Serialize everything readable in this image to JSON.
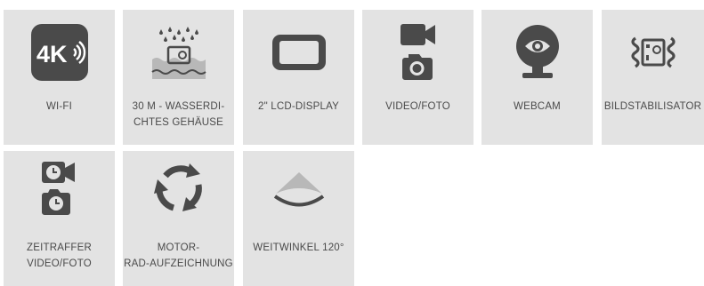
{
  "features": [
    {
      "icon": "4k-wifi-icon",
      "lines": [
        "WI-FI"
      ]
    },
    {
      "icon": "waterproof-housing-icon",
      "lines": [
        "30 M - WASSERDI-",
        "CHTES GEHÄUSE"
      ]
    },
    {
      "icon": "lcd-display-icon",
      "lines": [
        "2\" LCD-DISPLAY"
      ]
    },
    {
      "icon": "video-photo-icon",
      "lines": [
        "VIDEO/FOTO"
      ]
    },
    {
      "icon": "webcam-icon",
      "lines": [
        "WEBCAM"
      ]
    },
    {
      "icon": "image-stabilizer-icon",
      "lines": [
        "BILDSTABILISATOR"
      ]
    },
    {
      "icon": "timelapse-icon",
      "lines": [
        "ZEITRAFFER",
        "VIDEO/FOTO"
      ]
    },
    {
      "icon": "loop-recording-icon",
      "lines": [
        "MOTOR-",
        "RAD-AUFZEICHNUNG"
      ]
    },
    {
      "icon": "wide-angle-icon",
      "lines": [
        "WEITWINKEL 120°"
      ]
    }
  ],
  "colors": {
    "tile_bg": "#e3e3e3",
    "icon": "#4a4a4a",
    "text": "#4a4a4a",
    "water": "#b8b8b8"
  }
}
